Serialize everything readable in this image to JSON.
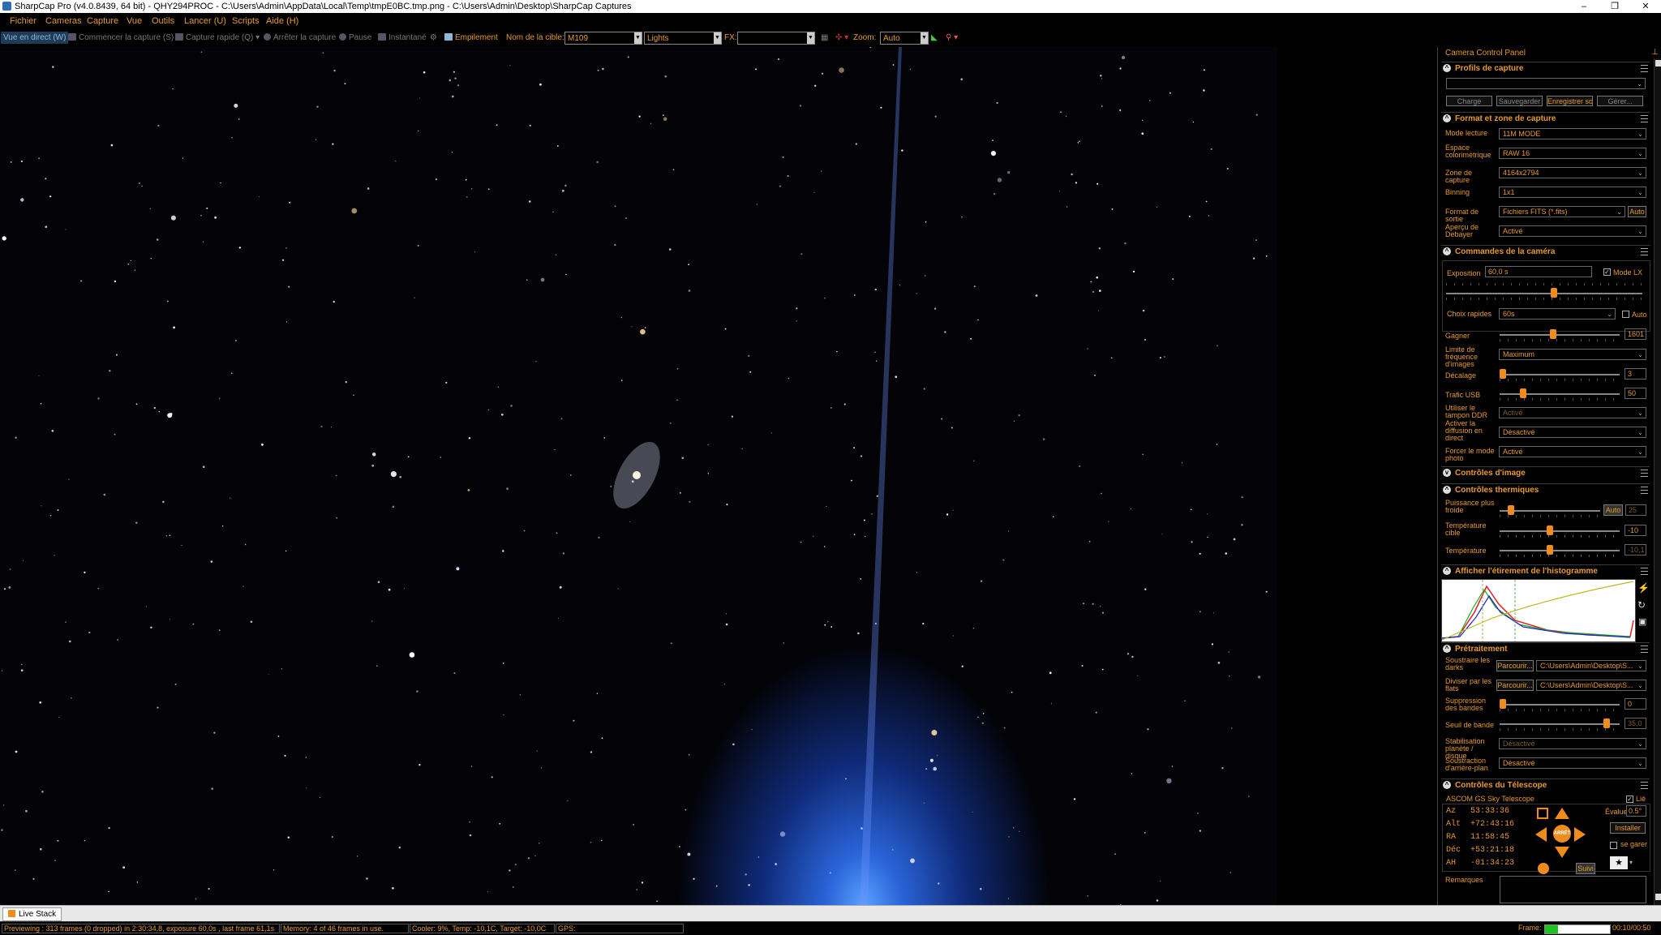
{
  "window": {
    "title": "SharpCap Pro (v4.0.8439, 64 bit) - QHY294PROC - C:\\Users\\Admin\\AppData\\Local\\Temp\\tmpE0BC.tmp.png - C:\\Users\\Admin\\Desktop\\SharpCap Captures",
    "minimize": "–",
    "maximize": "❐",
    "close": "✕"
  },
  "menu": [
    "Fichier",
    "Cameras",
    "Capture",
    "Vue",
    "Outils",
    "Lancer (U)",
    "Scripts",
    "Aide (H)"
  ],
  "toolbar": {
    "live_view": "Vue en direct (W)",
    "start_capture": "Commencer la capture (S)",
    "quick_capture": "Capture rapide (Q)",
    "stop_capture": "Arrêter la capture",
    "pause": "Pause",
    "snapshot": "Instantané",
    "stacking": "Empilement",
    "target_label": "Nom de la cible:",
    "target_value": "M109",
    "frame_type": "Lights",
    "fx_label": "FX:",
    "fx_value": "",
    "zoom_label": "Zoom:",
    "zoom_value": "Auto"
  },
  "panel": {
    "title": "Camera Control Panel",
    "profiles": {
      "header": "Profils de capture",
      "profile_value": "",
      "load": "Charge",
      "save": "Sauvegarder",
      "save_as": "Enregistrer so",
      "manage": "Gérer..."
    },
    "format": {
      "header": "Format et zone de capture",
      "read_mode_label": "Mode lecture",
      "read_mode": "11M MODE",
      "color_space_label": "Espace colorimétrique",
      "color_space": "RAW 16",
      "capture_area_label": "Zone de capture",
      "capture_area": "4164x2794",
      "binning_label": "Binning",
      "binning": "1x1",
      "output_format_label": "Format de sortie",
      "output_format": "Fichiers FITS (*.fits)",
      "auto": "Auto",
      "debayer_label": "Aperçu de Debayer",
      "debayer": "Activé"
    },
    "camera": {
      "header": "Commandes de la caméra",
      "exposure_label": "Exposition",
      "exposure": "60,0 s",
      "lx_mode": "Mode LX",
      "quick_label": "Choix rapides",
      "quick": "60s",
      "auto": "Auto",
      "gain_label": "Gagner",
      "gain": "1601",
      "fps_label": "Limite de fréquence d'images",
      "fps": "Maximum",
      "offset_label": "Décalage",
      "offset": "3",
      "usb_label": "Trafic USB",
      "usb": "50",
      "ddr_label": "Utiliser le tampon DDR",
      "ddr": "Activé",
      "stream_label": "Activer la diffusion en direct",
      "stream": "Désactivé",
      "photo_label": "Forcer le mode photo",
      "photo": "Activé"
    },
    "image_controls": {
      "header": "Contrôles d'image"
    },
    "thermal": {
      "header": "Contrôles thermiques",
      "cooler_label": "Puissance plus froide",
      "auto": "Auto",
      "cooler_value": "25",
      "target_label": "Température cible",
      "target_value": "-10",
      "temp_label": "Température",
      "temp_value": "-10,1"
    },
    "histogram": {
      "header": "Afficher l'étirement de l'histogramme"
    },
    "preprocessing": {
      "header": "Prétraitement",
      "darks_label": "Soustraire les darks",
      "browse": "Parcourir...",
      "darks_path": "C:\\Users\\Admin\\Desktop\\S...",
      "flats_label": "Diviser par les flats",
      "flats_path": "C:\\Users\\Admin\\Desktop\\S...",
      "banding_label": "Suppression des bandes",
      "banding": "0",
      "threshold_label": "Seuil de bande",
      "threshold": "35,0",
      "stab_label": "Stabilisation planète / disque",
      "stab": "Désactivé",
      "bg_label": "Soustraction d'arrière-plan",
      "bg": "Désactivé"
    },
    "telescope": {
      "header": "Contrôles du Télescope",
      "name": "ASCOM GS Sky Telescope",
      "linked": "Lié",
      "az": "Az   53:33:36",
      "alt": "Alt  +72:43:16",
      "ra": "RA   11:58:45",
      "dec": "Déc  +53:21:18",
      "ah": "AH   -01:34:23",
      "rate_label": "Évaluer",
      "rate": "0.5°",
      "install": "Installer",
      "park": "se garer",
      "follow": "Suivi",
      "stop": "ARRÊT"
    },
    "notes_label": "Remarques"
  },
  "live_stack_tab": "Live Stack",
  "status": {
    "preview": "Previewing : 313 frames (0 dropped) in 2:30:34,8, exposure 60,0s , last frame 61,1s",
    "memory": "Memory: 4 of 46 frames in use.",
    "cooler": "Cooler: 9%, Temp: -10,1C, Target: -10,0C",
    "gps": "GPS:",
    "frame_label": "Frame:",
    "frame_time": "00:10/00:50",
    "frame_progress": 0.2
  },
  "colors": {
    "accent": "#e89a2c",
    "knob": "#f08c1e"
  }
}
